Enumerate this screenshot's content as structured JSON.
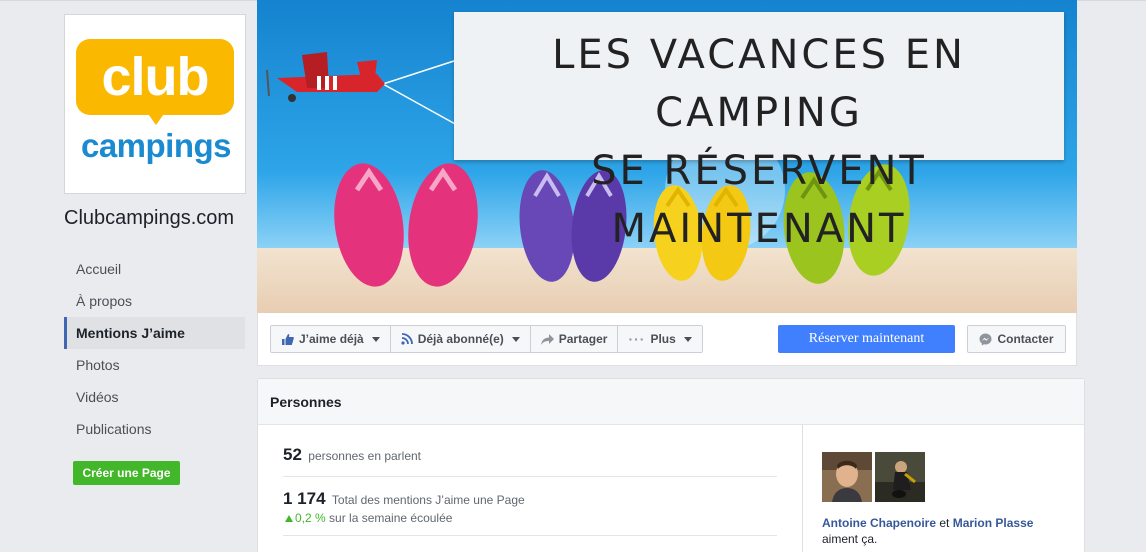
{
  "page": {
    "name": "Clubcampings.com",
    "logo": {
      "top_text": "club",
      "bottom_text": "campings",
      "brand_yellow": "#fbb800",
      "brand_blue": "#1a8ad1"
    }
  },
  "nav": {
    "items": [
      {
        "label": "Accueil",
        "active": false
      },
      {
        "label": "À propos",
        "active": false
      },
      {
        "label": "Mentions J’aime",
        "active": true
      },
      {
        "label": "Photos",
        "active": false
      },
      {
        "label": "Vidéos",
        "active": false
      },
      {
        "label": "Publications",
        "active": false
      }
    ],
    "create_page_label": "Créer une Page"
  },
  "cover": {
    "line1": "LES VACANCES EN CAMPING",
    "line2": "SE RÉSERVENT MAINTENANT"
  },
  "actions": {
    "like_label": "J’aime déjà",
    "follow_label": "Déjà abonné(e)",
    "share_label": "Partager",
    "more_label": "Plus",
    "book_label": "Réserver maintenant",
    "contact_label": "Contacter",
    "accent": "#4080ff"
  },
  "persons": {
    "title": "Personnes",
    "talking_count": "52",
    "talking_label": "personnes en parlent",
    "likes_count": "1 174",
    "likes_label": "Total des mentions J’aime une Page",
    "trend_value": "0,2 %",
    "trend_label": "sur la semaine écoulée",
    "friend1": "Antoine Chapenoire",
    "friend_connector": "et",
    "friend2": "Marion Plasse",
    "friends_suffix": "aiment ça."
  }
}
